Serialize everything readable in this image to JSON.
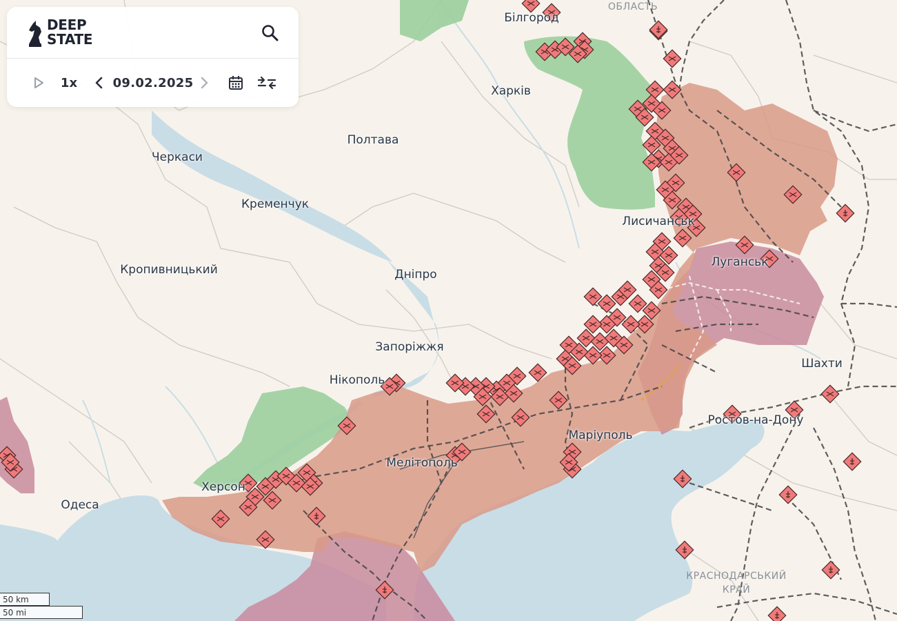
{
  "app": {
    "logo_line1": "DEEP",
    "logo_line2": "STATE"
  },
  "controls": {
    "speed": "1x",
    "date": "09.02.2025",
    "icons": [
      "play-icon",
      "chevron-left-icon",
      "chevron-right-icon",
      "calendar-icon",
      "collapse-icon",
      "search-icon"
    ]
  },
  "cities": [
    {
      "name": "Бiлгород"
    },
    {
      "name": "Харкiв"
    },
    {
      "name": "Полтава"
    },
    {
      "name": "Черкаси"
    },
    {
      "name": "Кременчук"
    },
    {
      "name": "Кропивницький"
    },
    {
      "name": "Днiпро"
    },
    {
      "name": "Лисичанськ"
    },
    {
      "name": "Луганськ"
    },
    {
      "name": "Запорiжжя"
    },
    {
      "name": "Нiкополь"
    },
    {
      "name": "Шахти"
    },
    {
      "name": "Ростов-на-Дону"
    },
    {
      "name": "Марiуполь"
    },
    {
      "name": "Мелiтополь"
    },
    {
      "name": "Херсон"
    },
    {
      "name": "Одеса"
    }
  ],
  "regions": [
    {
      "line1": "ОБЛАСТЬ",
      "line2": ""
    },
    {
      "line1": "КРАСНОДАРСЬКИЙ",
      "line2": "КРАЙ"
    }
  ],
  "scale": {
    "km": "50 km",
    "mi": "50 mi"
  },
  "colors": {
    "land": "#f7f3ec",
    "water": "#c9dde6",
    "occupied": "#d99a88",
    "occupied_pre2022": "#c98b9e",
    "liberated": "#9ccf9e",
    "marker": "#f07a7a",
    "rail": "#444444"
  }
}
